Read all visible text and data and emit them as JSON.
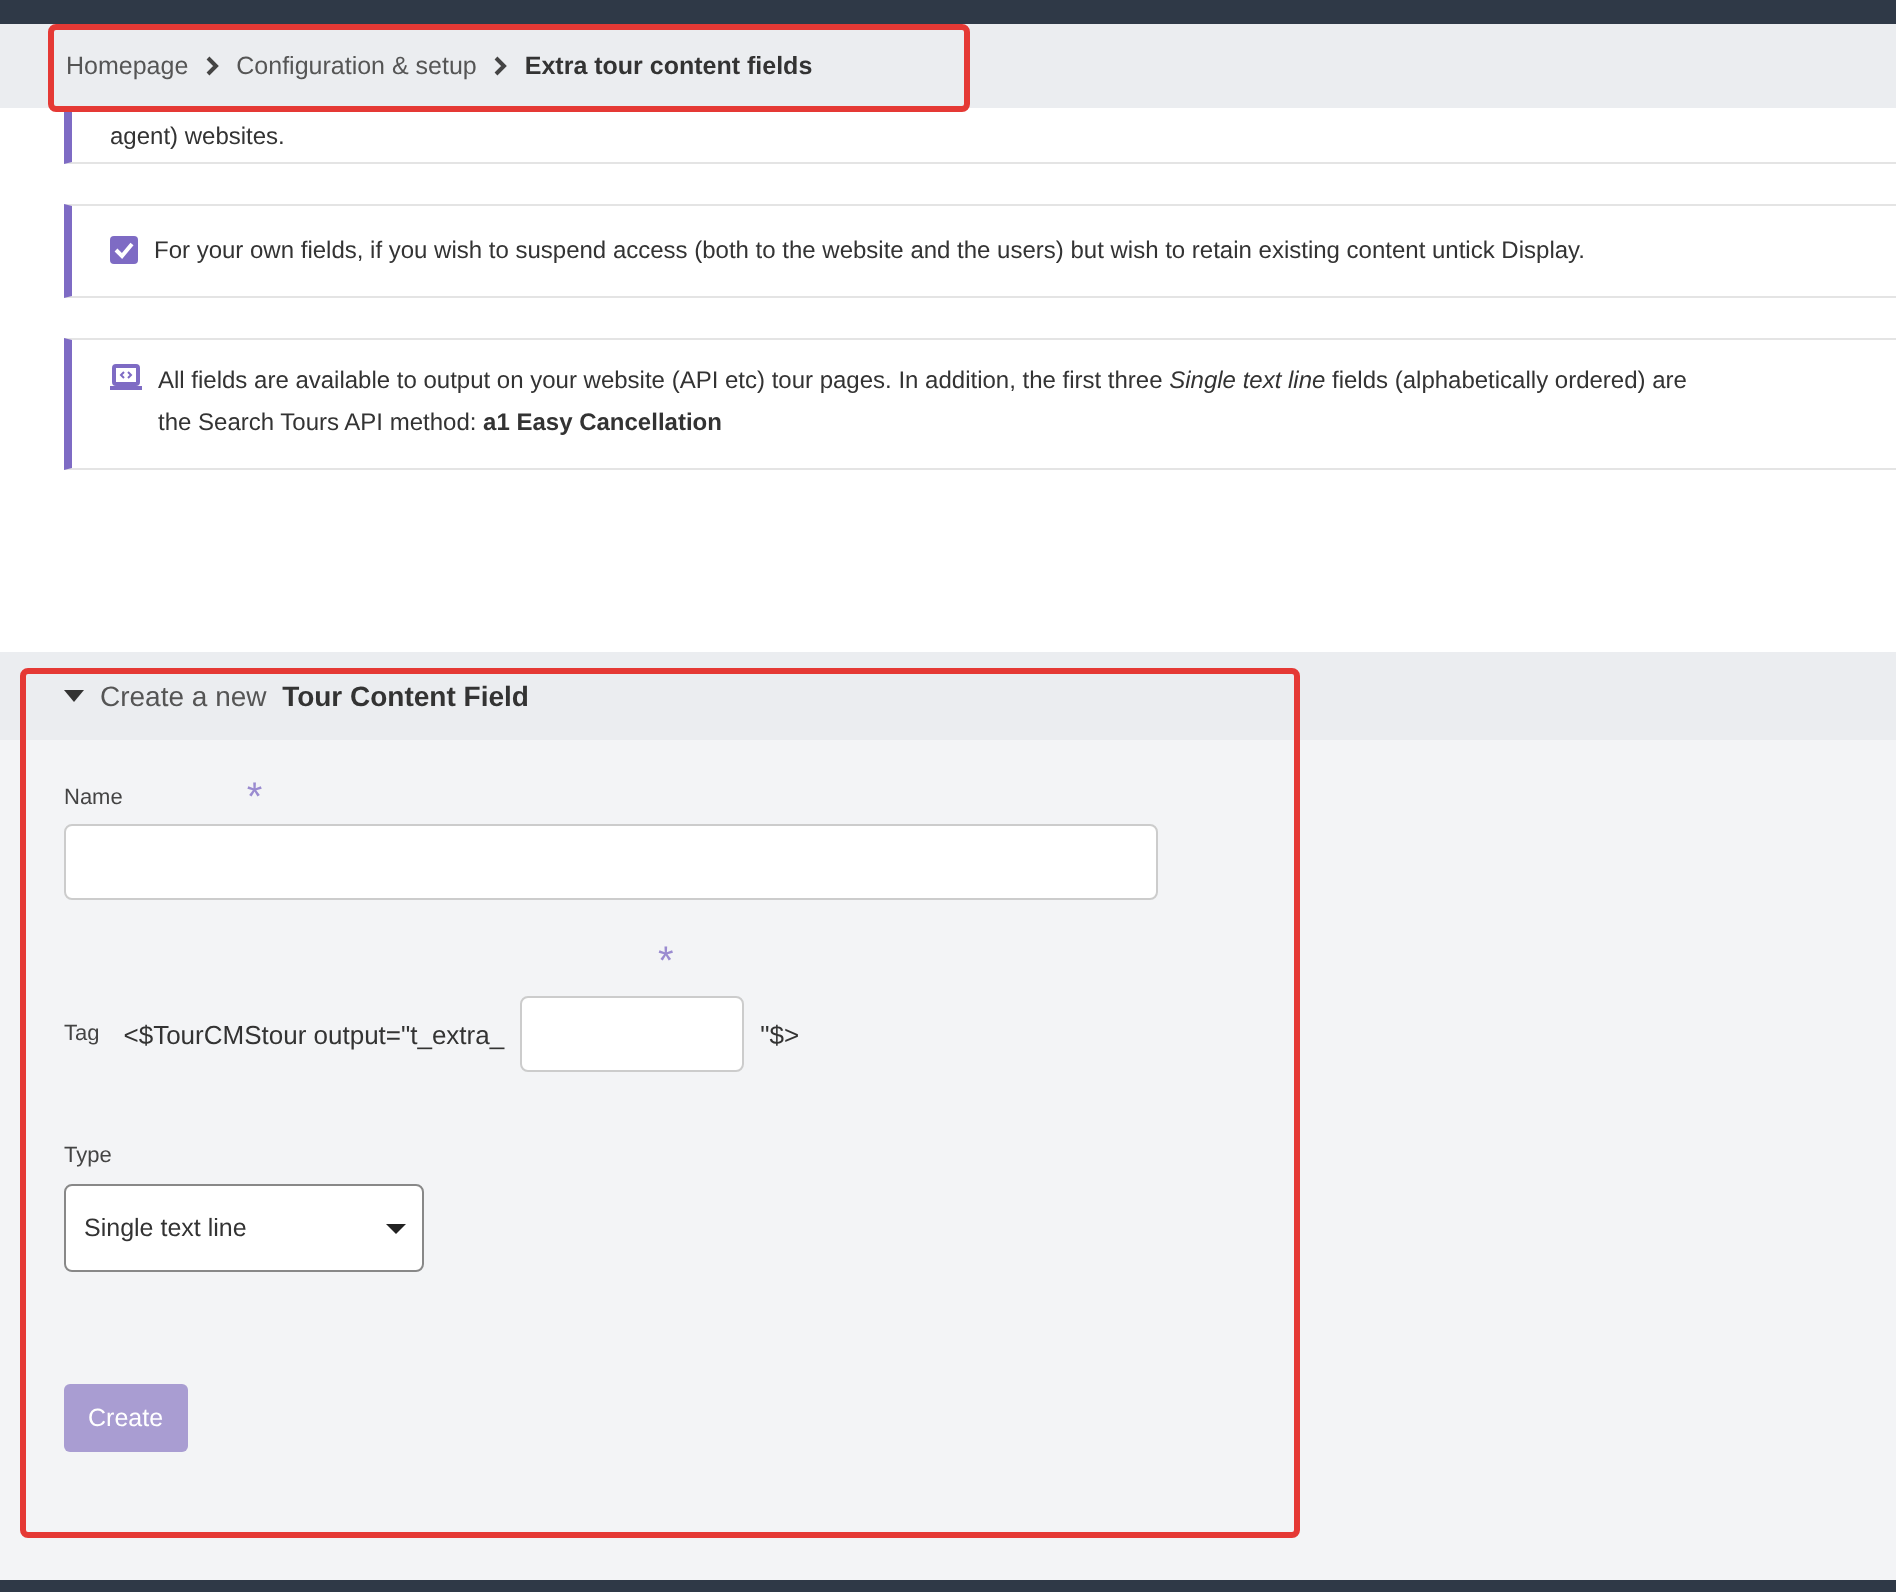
{
  "breadcrumb": {
    "items": [
      {
        "label": "Homepage",
        "current": false
      },
      {
        "label": "Configuration & setup",
        "current": false
      },
      {
        "label": "Extra tour content fields",
        "current": true
      }
    ],
    "highlighted": true
  },
  "notices": [
    {
      "kind": "plain",
      "lines": [
        "agent) websites."
      ]
    },
    {
      "kind": "checkbox",
      "lines": [
        "For your own fields, if you wish to suspend access (both to the website and the users) but wish to retain existing content untick Display."
      ]
    },
    {
      "kind": "laptop",
      "lines": [
        "All fields are available to output on your website (API etc) tour pages. In addition, the first three *Single text line* fields (alphabetically ordered) are",
        "the Search Tours API method: **a1 Easy Cancellation**"
      ]
    }
  ],
  "create_form": {
    "highlighted": true,
    "expanded": true,
    "title_prefix": "Create a new",
    "title": "Tour Content Field",
    "name_field": {
      "label": "Name",
      "required_mark": "*"
    },
    "tag_field": {
      "label": "Tag",
      "prefix": "<$TourCMStour output=\"t_extra_",
      "suffix": "\"$>",
      "required_mark": "*"
    },
    "type_field": {
      "label": "Type",
      "value": "Single text line"
    },
    "create_button": {
      "label": "Create",
      "disabled": true
    }
  }
}
